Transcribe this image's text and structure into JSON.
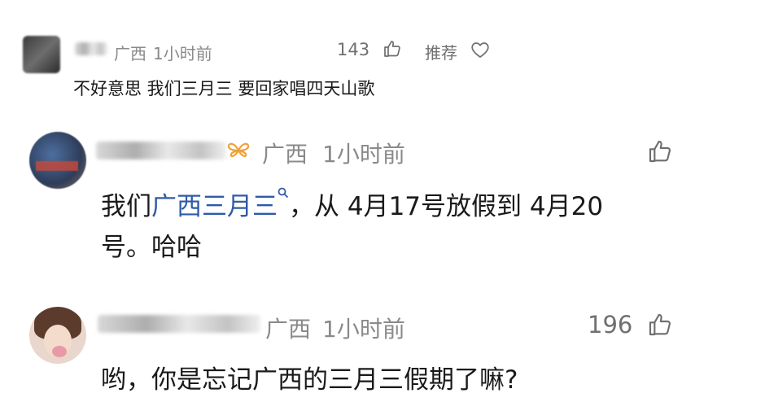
{
  "comments": [
    {
      "region": "广西",
      "time": "1小时前",
      "likes": "143",
      "recommend_label": "推荐",
      "text": "不好意思 我们三月三 要回家唱四天山歌"
    },
    {
      "region": "广西",
      "time": "1小时前",
      "text_before": "我们",
      "link": "广西三月三",
      "text_after_line1": "，从 4月17号放假到 4月20",
      "text_line2": "号。哈哈"
    },
    {
      "region": "广西",
      "time": "1小时前",
      "likes": "196",
      "text": "哟，你是忘记广西的三月三假期了嘛?"
    }
  ],
  "icons": {
    "like": "thumbs-up-icon",
    "recommend": "heart-icon",
    "search": "search-icon",
    "badge": "butterfly-icon"
  },
  "colors": {
    "link": "#2f5aa8",
    "meta": "#8a8a8a",
    "text": "#1a1a1a",
    "badge": "#f0a23a"
  }
}
